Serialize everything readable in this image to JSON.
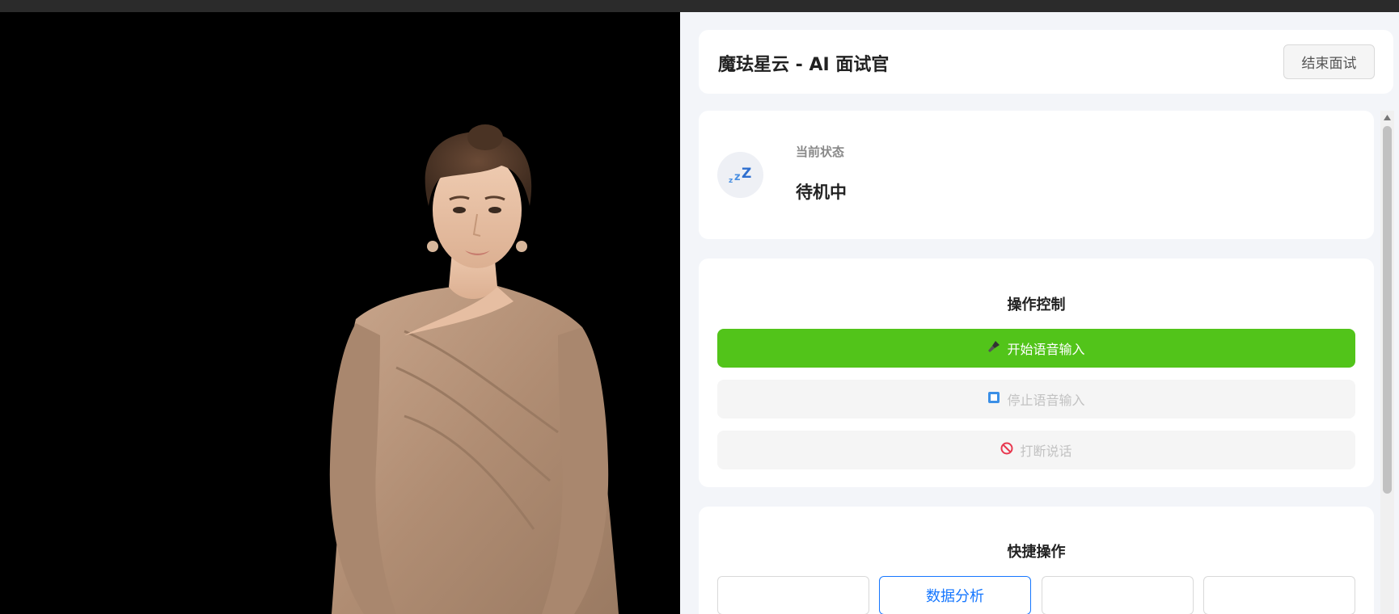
{
  "header": {
    "title": "魔珐星云 - AI 面试官",
    "end_button": "结束面试"
  },
  "status": {
    "label": "当前状态",
    "value": "待机中",
    "icon": "sleeping-zzz-icon"
  },
  "controls": {
    "title": "操作控制",
    "start_voice": "开始语音输入",
    "stop_voice": "停止语音输入",
    "interrupt": "打断说话",
    "start_icon": "microphone-icon",
    "stop_icon": "stop-square-icon",
    "interrupt_icon": "prohibited-icon"
  },
  "quick_actions": {
    "title": "快捷操作",
    "items": [
      "",
      "数据分析",
      "",
      ""
    ]
  },
  "colors": {
    "accent_green": "#52c41a",
    "accent_blue": "#1677ff"
  }
}
